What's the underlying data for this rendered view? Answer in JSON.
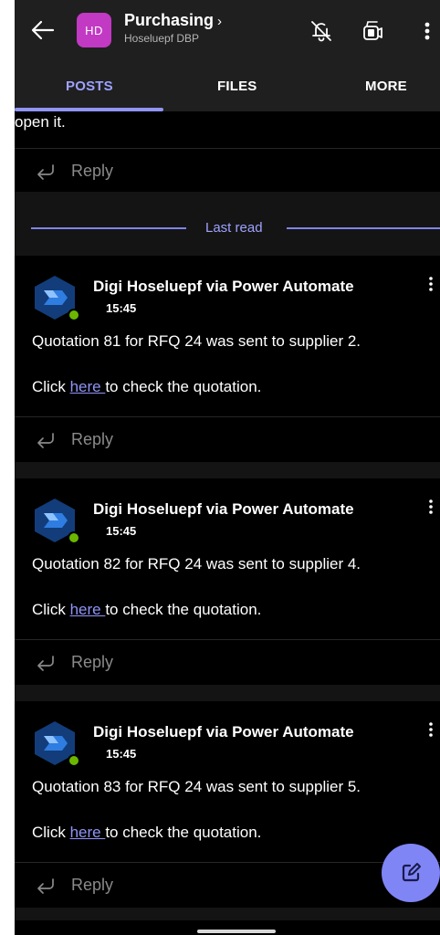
{
  "header": {
    "avatar_initials": "HD",
    "channel_title": "Purchasing",
    "chevron": "›",
    "team_name": "Hoseluepf DBP"
  },
  "tabs": [
    {
      "label": "POSTS",
      "active": true
    },
    {
      "label": "FILES",
      "active": false
    },
    {
      "label": "MORE",
      "active": false
    }
  ],
  "partial_post": {
    "text": "open it.",
    "reply_label": "Reply"
  },
  "last_read_label": "Last read",
  "posts": [
    {
      "sender": "Digi Hoseluepf via Power Automate",
      "time": "15:45",
      "message": "Quotation 81 for RFQ 24 was sent to supplier 2.",
      "link_prefix": "Click ",
      "link_text": "here ",
      "link_suffix": " to check the quotation.",
      "reply_label": "Reply"
    },
    {
      "sender": "Digi Hoseluepf via Power Automate",
      "time": "15:45",
      "message": "Quotation 82 for RFQ 24 was sent to supplier 4.",
      "link_prefix": "Click ",
      "link_text": "here ",
      "link_suffix": " to check the quotation.",
      "reply_label": "Reply"
    },
    {
      "sender": "Digi Hoseluepf via Power Automate",
      "time": "15:45",
      "message": "Quotation 83 for RFQ 24 was sent to supplier 5.",
      "link_prefix": "Click ",
      "link_text": "here ",
      "link_suffix": " to check the quotation.",
      "reply_label": "Reply"
    }
  ],
  "icons": {
    "back": "arrow-left-icon",
    "mute": "bell-off-icon",
    "meet": "video-call-icon",
    "more": "more-vertical-icon",
    "reply": "reply-arrow-icon",
    "compose": "compose-icon"
  },
  "colors": {
    "accent": "#8f94f5",
    "avatar": "#c239c3",
    "presence": "#6bb700"
  }
}
